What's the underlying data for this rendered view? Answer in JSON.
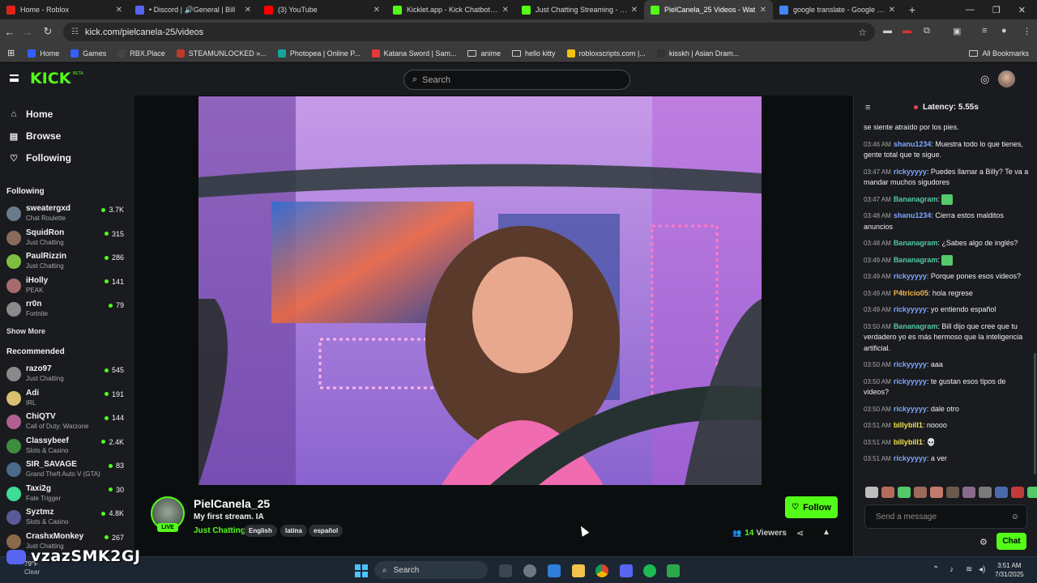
{
  "browser": {
    "tabs": [
      {
        "title": "Home - Roblox",
        "color": "#e2231a",
        "active": false
      },
      {
        "title": "• Discord | 🔊General | Bill",
        "color": "#5865f2",
        "active": false
      },
      {
        "title": "(3) YouTube",
        "color": "#ff0000",
        "active": false
      },
      {
        "title": "Kicklet.app - Kick Chatbot and",
        "color": "#53fc18",
        "active": false
      },
      {
        "title": "Just Chatting Streaming - Live S",
        "color": "#53fc18",
        "active": false
      },
      {
        "title": "PielCanela_25 Videos - Wat",
        "color": "#53fc18",
        "active": true
      },
      {
        "title": "google translate - Google Sear",
        "color": "#4285f4",
        "active": false
      }
    ],
    "url": "kick.com/pielcanela-25/videos",
    "bookmarks": [
      {
        "label": "Home",
        "color": "#335fff",
        "folder": false
      },
      {
        "label": "Games",
        "color": "#335fff",
        "folder": false
      },
      {
        "label": "RBX.Place",
        "color": "#444444",
        "folder": false
      },
      {
        "label": "STEAMUNLOCKED »...",
        "color": "#c0392b",
        "folder": false
      },
      {
        "label": "Photopea | Online P...",
        "color": "#18a497",
        "folder": false
      },
      {
        "label": "Katana Sword | Sam...",
        "color": "#e53935",
        "folder": false
      },
      {
        "label": "anime",
        "color": "",
        "folder": true
      },
      {
        "label": "hello kitty",
        "color": "",
        "folder": true
      },
      {
        "label": "robloxscripts.com |...",
        "color": "#f1c40f",
        "folder": false
      },
      {
        "label": "kisskh | Asian Dram...",
        "color": "#333333",
        "folder": false
      }
    ],
    "all_bookmarks": "All Bookmarks"
  },
  "kick": {
    "logo": "KICK",
    "beta": "BETA",
    "search_placeholder": "Search",
    "nav": {
      "home": "Home",
      "browse": "Browse",
      "following": "Following"
    },
    "following_title": "Following",
    "following": [
      {
        "name": "sweatergxd",
        "game": "Chat Roulette",
        "viewers": "3.7K",
        "color": "#6b7b8c"
      },
      {
        "name": "SquidRon",
        "game": "Just Chatting",
        "viewers": "315",
        "color": "#8b6a5a"
      },
      {
        "name": "PaulRizzin",
        "game": "Just Chatting",
        "viewers": "286",
        "color": "#7fbf3f"
      },
      {
        "name": "iHolly",
        "game": "PEAK",
        "viewers": "141",
        "color": "#a86b6b"
      },
      {
        "name": "rr0n",
        "game": "Fortnite",
        "viewers": "79",
        "color": "#8a8a8a"
      }
    ],
    "show_more": "Show More",
    "recommended_title": "Recommended",
    "recommended": [
      {
        "name": "razo97",
        "game": "Just Chatting",
        "viewers": "545",
        "color": "#8a8a8a"
      },
      {
        "name": "Adi",
        "game": "IRL",
        "viewers": "191",
        "color": "#d8c070"
      },
      {
        "name": "ChiQTV",
        "game": "Call of Duty: Warzone",
        "viewers": "144",
        "color": "#b06090"
      },
      {
        "name": "Classybeef",
        "game": "Slots & Casino",
        "viewers": "2.4K",
        "color": "#3e8e3e"
      },
      {
        "name": "SIR_SAVAGE",
        "game": "Grand Theft Auto V (GTA)",
        "viewers": "83",
        "color": "#4a6a8a"
      },
      {
        "name": "Taxi2g",
        "game": "Fate Trigger",
        "viewers": "30",
        "color": "#3ddc97"
      },
      {
        "name": "Syztmz",
        "game": "Slots & Casino",
        "viewers": "4.8K",
        "color": "#5a5a9a"
      },
      {
        "name": "CrashxMonkey",
        "game": "Just Chatting",
        "viewers": "267",
        "color": "#8a6a4a"
      }
    ]
  },
  "stream": {
    "streamer": "PielCanela_25",
    "live_label": "LIVE",
    "title": "My first stream.  IA",
    "category": "Just Chatting",
    "tags": [
      "English",
      "latina",
      "español"
    ],
    "follow_label": "Follow",
    "viewers": "14",
    "viewers_label": "Viewers"
  },
  "chat": {
    "latency": "Latency: 5.55s",
    "messages": [
      {
        "time": "",
        "user": "",
        "color": "#ffffff",
        "text": "se siente atraído por los pies."
      },
      {
        "time": "03:46 AM",
        "user": "shanu1234",
        "color": "#7fa7ff",
        "text": "Muestra todo lo que tienes, gente total que te sigue."
      },
      {
        "time": "03:47 AM",
        "user": "rickyyyyy",
        "color": "#7fa7ff",
        "text": "Puedes llamar a Billy? Te va a mandar muchos sigudores"
      },
      {
        "time": "03:47 AM",
        "user": "Bananagram",
        "color": "#53c9a6",
        "text": "",
        "emote": true
      },
      {
        "time": "03:48 AM",
        "user": "shanu1234",
        "color": "#7fa7ff",
        "text": "Cierra estos malditos anuncios"
      },
      {
        "time": "03:48 AM",
        "user": "Bananagram",
        "color": "#53c9a6",
        "text": "¿Sabes algo de inglés?"
      },
      {
        "time": "03:49 AM",
        "user": "Bananagram",
        "color": "#53c9a6",
        "text": "",
        "emote": true
      },
      {
        "time": "03:49 AM",
        "user": "rickyyyyy",
        "color": "#7fa7ff",
        "text": "Porque pones esos videos?"
      },
      {
        "time": "03:49 AM",
        "user": "P4tricio05",
        "color": "#f2b84b",
        "text": "hola regrese"
      },
      {
        "time": "03:49 AM",
        "user": "rickyyyyy",
        "color": "#7fa7ff",
        "text": "yo entiendo español"
      },
      {
        "time": "03:50 AM",
        "user": "Bananagram",
        "color": "#53c9a6",
        "text": "Bill dijo que cree que tu verdadero yo es más hermoso que la inteligencia artificial."
      },
      {
        "time": "03:50 AM",
        "user": "rickyyyyy",
        "color": "#7fa7ff",
        "text": "aaa"
      },
      {
        "time": "03:50 AM",
        "user": "rickyyyyy",
        "color": "#7fa7ff",
        "text": "te gustan esos tipos de videos?"
      },
      {
        "time": "03:50 AM",
        "user": "rickyyyyy",
        "color": "#7fa7ff",
        "text": "dale otro"
      },
      {
        "time": "03:51 AM",
        "user": "billybill1",
        "color": "#f2e14b",
        "text": "noooo"
      },
      {
        "time": "03:51 AM",
        "user": "billybill1",
        "color": "#f2e14b",
        "text": "💀"
      },
      {
        "time": "03:51 AM",
        "user": "rickyyyyy",
        "color": "#7fa7ff",
        "text": "a ver"
      }
    ],
    "input_placeholder": "Send a message",
    "chat_button": "Chat"
  },
  "taskbar": {
    "temp": "79°F",
    "weather": "Clear",
    "search": "Search",
    "time": "3:51 AM",
    "date": "7/31/2025",
    "watermark": "vzazSMK2GJ"
  }
}
